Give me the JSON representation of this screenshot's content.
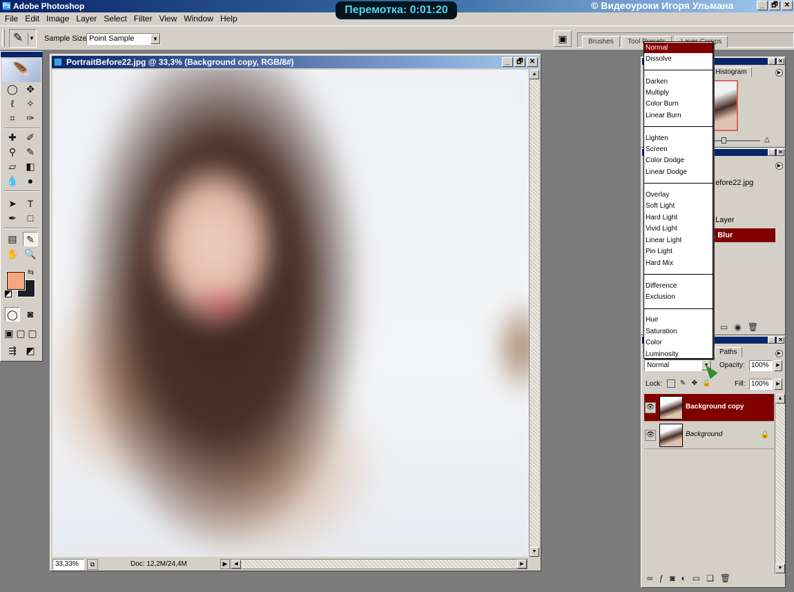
{
  "app": {
    "title": "Adobe Photoshop",
    "app_icon": "Ps"
  },
  "overlay": {
    "rewind": "Перемотка: 0:01:20",
    "copyright": "© Видеоуроки Игоря Ульмана"
  },
  "window_buttons": {
    "minimize": "_",
    "restore": "🗗",
    "close": "✕"
  },
  "menu": [
    "File",
    "Edit",
    "Image",
    "Layer",
    "Select",
    "Filter",
    "View",
    "Window",
    "Help"
  ],
  "options": {
    "sample_size_label": "Sample Size:",
    "sample_size_value": "Point Sample"
  },
  "well_tabs": [
    "Brushes",
    "Tool Presets",
    "Layer Comps"
  ],
  "document": {
    "title": "PortraitBefore22.jpg @ 33,3% (Background copy, RGB/8#)",
    "zoom": "33,33%",
    "doc_size": "Doc: 12,2M/24,4M"
  },
  "navigator": {
    "tab": "Histogram"
  },
  "history": {
    "file": "...efore22.jpg",
    "rows": [
      "...",
      "...Layer",
      "... Blur"
    ]
  },
  "layers": {
    "tab": "Paths",
    "blend_mode": "Normal",
    "opacity_label": "Opacity:",
    "opacity": "100%",
    "lock_label": "Lock:",
    "fill_label": "Fill:",
    "fill": "100%",
    "items": [
      {
        "name": "Background copy",
        "selected": true,
        "locked": false
      },
      {
        "name": "Background",
        "selected": false,
        "locked": true
      }
    ]
  },
  "blend_menu": {
    "groups": [
      [
        "Normal",
        "Dissolve"
      ],
      [
        "Darken",
        "Multiply",
        "Color Burn",
        "Linear Burn"
      ],
      [
        "Lighten",
        "Screen",
        "Color Dodge",
        "Linear Dodge"
      ],
      [
        "Overlay",
        "Soft Light",
        "Hard Light",
        "Vivid Light",
        "Linear Light",
        "Pin Light",
        "Hard Mix"
      ],
      [
        "Difference",
        "Exclusion"
      ],
      [
        "Hue",
        "Saturation",
        "Color",
        "Luminosity"
      ]
    ],
    "selected": "Normal"
  },
  "colors": {
    "foreground": "#f6a77f",
    "background": "#1b1e27",
    "selection": "#800000",
    "titlebar": "#0a246a"
  },
  "icons": {
    "eye": "👁",
    "lock": "🔒",
    "link": "∞",
    "fx": "ƒ",
    "mask": "◙",
    "adjust": "◐",
    "folder": "▭",
    "new": "❏",
    "trash": "🗑",
    "tools": [
      "marquee",
      "move",
      "lasso",
      "magic-wand",
      "crop",
      "slice",
      "healing",
      "brush",
      "stamp",
      "history-brush",
      "eraser",
      "gradient",
      "blur",
      "dodge",
      "path-select",
      "type",
      "pen",
      "shape",
      "notes",
      "eyedropper",
      "hand",
      "zoom"
    ]
  }
}
